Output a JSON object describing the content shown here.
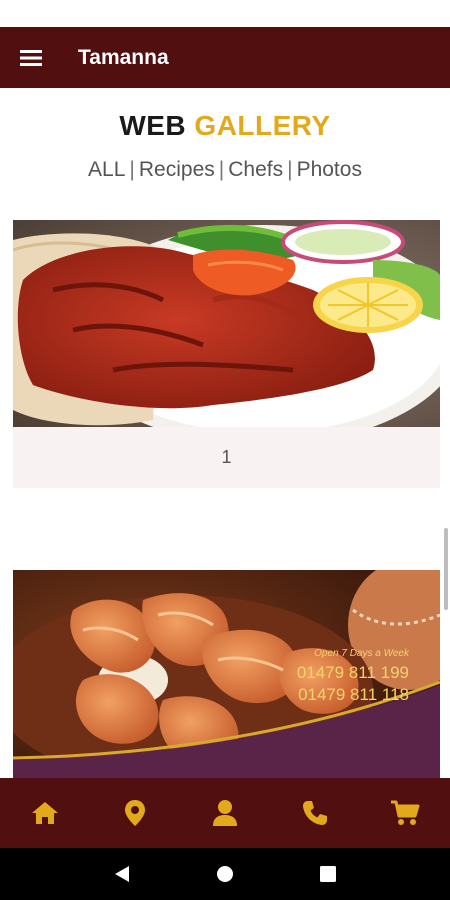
{
  "app": {
    "title": "Tamanna"
  },
  "gallery": {
    "heading_part1": "WEB",
    "heading_part2": "GALLERY",
    "filters": [
      "ALL",
      "Recipes",
      "Chefs",
      "Photos"
    ],
    "separator": "|"
  },
  "items": [
    {
      "caption": "1",
      "image": "doner-kebab-plate-photo"
    },
    {
      "image": "prawn-curry-promo-photo",
      "promo_text": "Open 7 Days a Week",
      "phones": [
        "01479 811 199",
        "01479 811 118"
      ]
    }
  ],
  "bottom_nav": [
    "home-icon",
    "location-pin-icon",
    "user-icon",
    "phone-icon",
    "cart-icon"
  ],
  "system_nav": [
    "back-icon",
    "home-circle-icon",
    "recents-icon"
  ],
  "colors": {
    "bar": "#520f10",
    "accent": "#e3a91c",
    "caption_bg": "#f8f3f2"
  }
}
